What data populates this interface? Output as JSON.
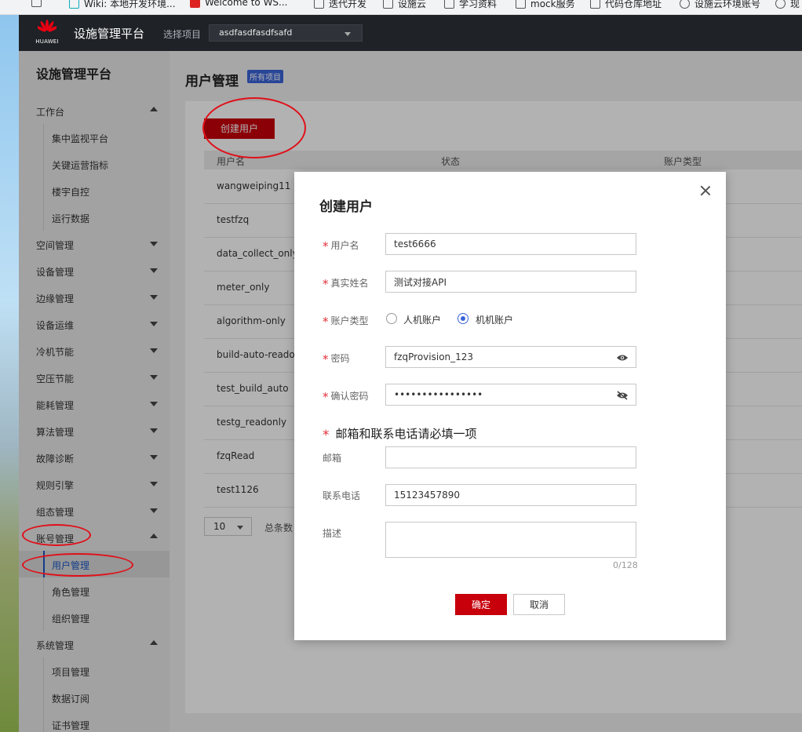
{
  "bookmarks": [
    {
      "label": "Wiki: 本地开发环境...",
      "icon": "tab-icon"
    },
    {
      "label": "Welcome to WS...",
      "icon": "tab-icon"
    },
    {
      "label": "迭代开发",
      "icon": "folder-icon"
    },
    {
      "label": "设施云",
      "icon": "folder-icon"
    },
    {
      "label": "学习资料",
      "icon": "folder-icon"
    },
    {
      "label": "mock服务",
      "icon": "folder-icon"
    },
    {
      "label": "代码仓库地址",
      "icon": "folder-icon"
    },
    {
      "label": "设施云环境账号",
      "icon": "globe-icon"
    },
    {
      "label": "现",
      "icon": "globe-icon"
    }
  ],
  "header": {
    "brand": "HUAWEI",
    "app_title": "设施管理平台",
    "project_label": "选择项目",
    "project_value": "asdfasdfasdfsafd"
  },
  "sidebar": {
    "title": "设施管理平台",
    "items": [
      {
        "label": "工作台",
        "type": "group",
        "expanded": true
      },
      {
        "label": "集中监视平台",
        "type": "sub"
      },
      {
        "label": "关键运营指标",
        "type": "sub"
      },
      {
        "label": "楼宇自控",
        "type": "sub"
      },
      {
        "label": "运行数据",
        "type": "sub"
      },
      {
        "label": "空间管理",
        "type": "group",
        "expanded": false
      },
      {
        "label": "设备管理",
        "type": "group",
        "expanded": false
      },
      {
        "label": "边缘管理",
        "type": "group",
        "expanded": false
      },
      {
        "label": "设备运维",
        "type": "group",
        "expanded": false
      },
      {
        "label": "冷机节能",
        "type": "group",
        "expanded": false
      },
      {
        "label": "空压节能",
        "type": "group",
        "expanded": false
      },
      {
        "label": "能耗管理",
        "type": "group",
        "expanded": false
      },
      {
        "label": "算法管理",
        "type": "group",
        "expanded": false
      },
      {
        "label": "故障诊断",
        "type": "group",
        "expanded": false
      },
      {
        "label": "规则引擎",
        "type": "group",
        "expanded": false
      },
      {
        "label": "组态管理",
        "type": "group",
        "expanded": false
      },
      {
        "label": "账号管理",
        "type": "group",
        "expanded": true
      },
      {
        "label": "用户管理",
        "type": "sub",
        "active": true
      },
      {
        "label": "角色管理",
        "type": "sub"
      },
      {
        "label": "组织管理",
        "type": "sub"
      },
      {
        "label": "系统管理",
        "type": "group",
        "expanded": true
      },
      {
        "label": "项目管理",
        "type": "sub"
      },
      {
        "label": "数据订阅",
        "type": "sub"
      },
      {
        "label": "证书管理",
        "type": "sub"
      }
    ]
  },
  "main": {
    "page_title": "用户管理",
    "page_badge": "所有项目",
    "create_button": "创建用户",
    "columns": [
      "用户名",
      "状态",
      "账户类型"
    ],
    "rows": [
      "wangweiping11",
      "testfzq",
      "data_collect_only",
      "meter_only",
      "algorithm-only",
      "build-auto-readonly",
      "test_build_auto",
      "testg_readonly",
      "fzqRead",
      "test1126"
    ],
    "page_size": "10",
    "total_label": "总条数："
  },
  "modal": {
    "title": "创建用户",
    "username_label": "用户名",
    "username_value": "test6666",
    "realname_label": "真实姓名",
    "realname_value": "测试对接API",
    "account_type_label": "账户类型",
    "account_type_options": [
      "人机账户",
      "机机账户"
    ],
    "account_type_selected": "机机账户",
    "password_label": "密码",
    "password_value": "fzqProvision_123",
    "confirm_label": "确认密码",
    "confirm_value": "••••••••••••••••",
    "notice": "邮箱和联系电话请必填一项",
    "email_label": "邮箱",
    "email_value": "",
    "phone_label": "联系电话",
    "phone_value": "15123457890",
    "desc_label": "描述",
    "desc_counter": "0/128",
    "ok_button": "确定",
    "cancel_button": "取消"
  },
  "colors": {
    "brand_red": "#c7000b",
    "header_bg": "#1f2227",
    "accent_blue": "#3a64d8",
    "annotation_red": "#e0101a"
  }
}
